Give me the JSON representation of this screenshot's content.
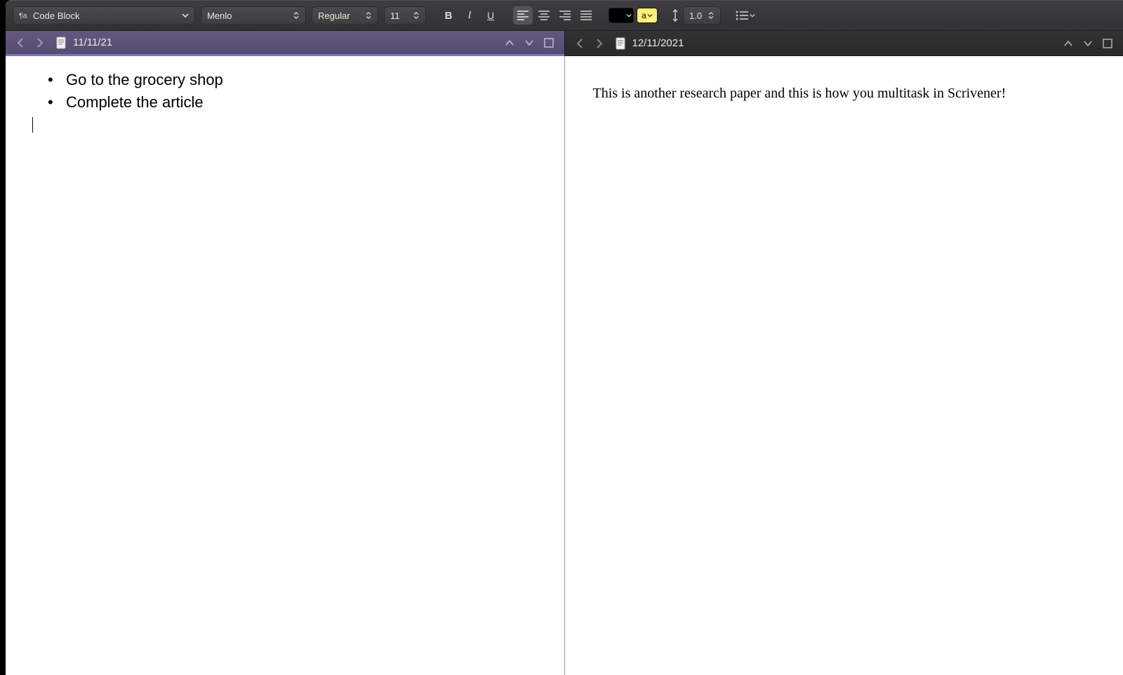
{
  "toolbar": {
    "style_label": "Code Block",
    "font_label": "Menlo",
    "weight_label": "Regular",
    "size_label": "11",
    "linespacing": "1.0",
    "highlight_sample": "a"
  },
  "panes": {
    "left": {
      "title": "11/11/21",
      "bullets": [
        "Go to the grocery shop",
        "Complete the article"
      ]
    },
    "right": {
      "title": "12/11/2021",
      "body": "This is another research paper and this is how you multitask in Scrivener!"
    }
  }
}
